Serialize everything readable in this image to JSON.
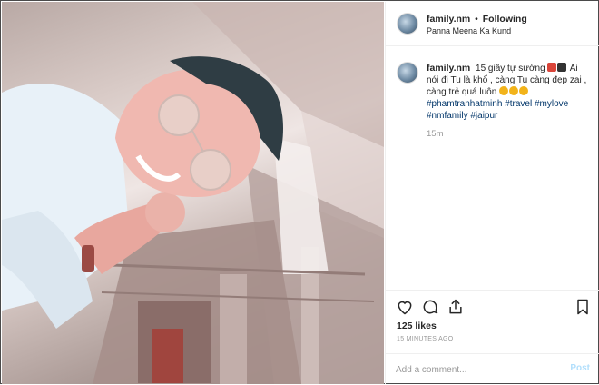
{
  "header": {
    "username": "family.nm",
    "separator": "•",
    "follow_status": "Following",
    "location": "Panna Meena Ka Kund"
  },
  "caption": {
    "username": "family.nm",
    "text_part1": "15 giây tự sướng",
    "text_part2": "Ai nói đi Tu là khổ , càng Tu càng đẹp zai , càng trẻ quá luôn",
    "hashtags": [
      "#phamtranhatminh",
      "#travel",
      "#mylove",
      "#nmfamily",
      "#jaipur"
    ],
    "age": "15m"
  },
  "actions": {
    "like_icon": "heart-icon",
    "comment_icon": "comment-bubble-icon",
    "share_icon": "share-icon",
    "save_icon": "bookmark-icon"
  },
  "likes": "125 likes",
  "timestamp": "15 MINUTES AGO",
  "comment_box": {
    "placeholder": "Add a comment...",
    "post_label": "Post"
  }
}
